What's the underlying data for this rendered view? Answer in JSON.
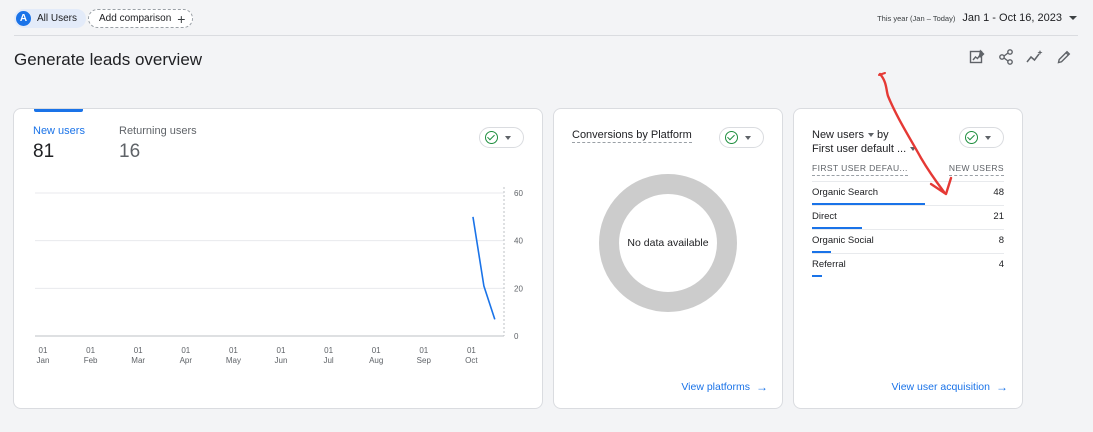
{
  "topbar": {
    "segment_initial": "A",
    "segment_label": "All Users",
    "add_comparison_label": "Add comparison",
    "date_range_sub": "This year (Jan – Today)",
    "date_range_main": "Jan 1 - Oct 16, 2023"
  },
  "page": {
    "title": "Generate leads overview",
    "actions": [
      "customize-report-icon",
      "share-icon",
      "insights-icon",
      "edit-icon"
    ]
  },
  "users_card": {
    "metrics": [
      {
        "label": "New users",
        "value": "81"
      },
      {
        "label": "Returning users",
        "value": "16"
      }
    ],
    "chart_data": {
      "type": "line",
      "x": [
        "01 Jan",
        "01 Feb",
        "01 Mar",
        "01 Apr",
        "01 May",
        "01 Jun",
        "01 Jul",
        "01 Aug",
        "01 Sep",
        "01 Oct"
      ],
      "x_ticks": [
        {
          "day": "01",
          "month": "Jan"
        },
        {
          "day": "01",
          "month": "Feb"
        },
        {
          "day": "01",
          "month": "Mar"
        },
        {
          "day": "01",
          "month": "Apr"
        },
        {
          "day": "01",
          "month": "May"
        },
        {
          "day": "01",
          "month": "Jun"
        },
        {
          "day": "01",
          "month": "Jul"
        },
        {
          "day": "01",
          "month": "Aug"
        },
        {
          "day": "01",
          "month": "Sep"
        },
        {
          "day": "01",
          "month": "Oct"
        }
      ],
      "y_ticks": [
        "60",
        "40",
        "20",
        "0"
      ],
      "ylim": [
        0,
        60
      ],
      "series": [
        {
          "values": [
            {
              "x": "2023-10-02",
              "y": 50
            },
            {
              "x": "2023-10-09",
              "y": 21
            },
            {
              "x": "2023-10-16",
              "y": 7
            }
          ],
          "color": "#1a73e8"
        }
      ],
      "grid": true
    }
  },
  "platform_card": {
    "title": "Conversions by Platform",
    "empty_text": "No data available",
    "link_label": "View platforms"
  },
  "acquisition_card": {
    "title_metric": "New users",
    "title_by": "by",
    "title_dimension": "First user default ...",
    "col_left": "FIRST USER DEFAU...",
    "col_right": "NEW USERS",
    "rows": [
      {
        "label": "Organic Search",
        "value": "48",
        "share": 0.59
      },
      {
        "label": "Direct",
        "value": "21",
        "share": 0.26
      },
      {
        "label": "Organic Social",
        "value": "8",
        "share": 0.1
      },
      {
        "label": "Referral",
        "value": "4",
        "share": 0.05
      }
    ],
    "link_label": "View user acquisition"
  },
  "colors": {
    "accent": "#1a73e8",
    "success": "#1e8e3e",
    "annotation": "#e53935",
    "donut": "#cccccc"
  }
}
